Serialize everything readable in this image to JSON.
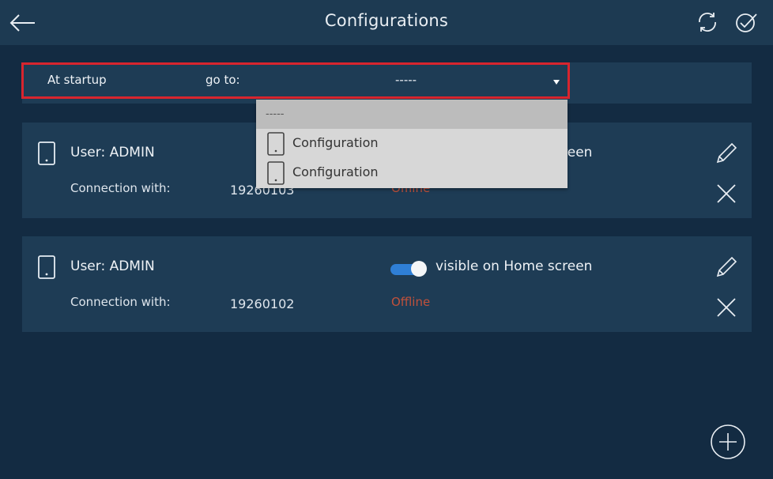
{
  "header": {
    "title": "Configurations",
    "icons": [
      "back-arrow-icon",
      "refresh-icon",
      "confirm-check-icon"
    ]
  },
  "startup": {
    "label": "At startup",
    "goto_label": "go to:",
    "selected_value": "-----"
  },
  "dropdown": {
    "empty_option": "-----",
    "options": [
      {
        "label": "Configuration",
        "icon": "phone-icon"
      },
      {
        "label": "Configuration",
        "icon": "phone-icon"
      }
    ]
  },
  "cards": [
    {
      "user": "User: ADMIN",
      "connection_label": "Connection with:",
      "connection_value": "19260103",
      "status": "Offline",
      "visibility_toggle_on": true,
      "visible_text": "visible on Home screen"
    },
    {
      "user": "User: ADMIN",
      "connection_label": "Connection with:",
      "connection_value": "19260102",
      "status": "Offline",
      "visibility_toggle_on": true,
      "visible_text": "visible on Home screen"
    }
  ],
  "colors": {
    "background": "#132b42",
    "panel": "#1e3c55",
    "accent_toggle": "#2f7fd6",
    "status_offline": "#c0513b",
    "highlight_border": "#d8252e"
  }
}
